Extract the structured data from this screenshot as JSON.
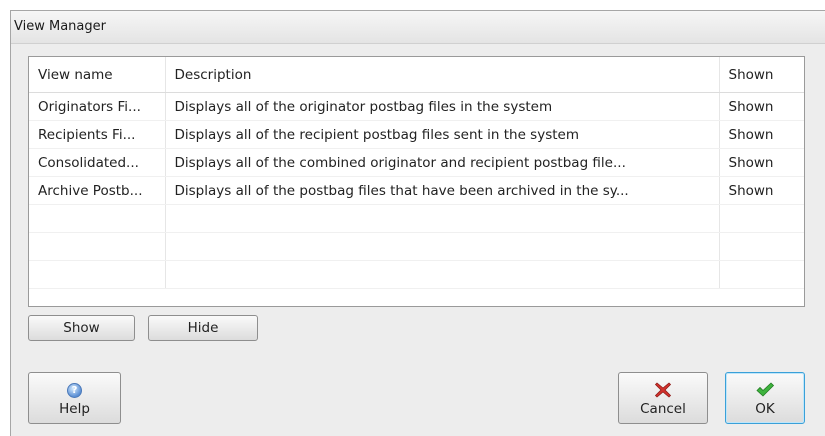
{
  "window": {
    "title": "View Manager"
  },
  "table": {
    "columns": [
      "View name",
      "Description",
      "Shown"
    ],
    "rows": [
      {
        "name": "Originators Fi...",
        "description": "Displays all of the originator postbag files in the system",
        "shown": "Shown"
      },
      {
        "name": "Recipients Fi...",
        "description": "Displays all of the recipient postbag files sent in the system",
        "shown": "Shown"
      },
      {
        "name": "Consolidated...",
        "description": "Displays all of the combined originator and recipient postbag file...",
        "shown": "Shown"
      },
      {
        "name": "Archive Postb...",
        "description": "Displays all of the postbag files that have been archived in the sy...",
        "shown": "Shown"
      }
    ]
  },
  "buttons": {
    "show": "Show",
    "hide": "Hide",
    "help": "Help",
    "cancel": "Cancel",
    "ok": "OK"
  },
  "icons": {
    "help": "help-icon",
    "cancel": "red-x-icon",
    "ok": "green-check-icon"
  }
}
